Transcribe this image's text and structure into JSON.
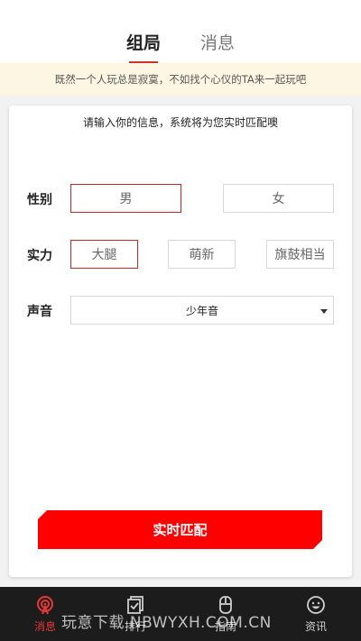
{
  "top_tabs": [
    {
      "label": "组局",
      "active": true
    },
    {
      "label": "消息",
      "active": false
    }
  ],
  "banner": {
    "text": "既然一个人玩总是寂寞，不如找个心仪的TA来一起玩吧"
  },
  "card": {
    "hint": "请输入你的信息，系统将为您实时匹配噢",
    "gender": {
      "label": "性别",
      "options": [
        "男",
        "女"
      ],
      "selected": "男"
    },
    "strength": {
      "label": "实力",
      "options": [
        "大腿",
        "萌新",
        "旗鼓相当"
      ],
      "selected": "大腿"
    },
    "voice": {
      "label": "声音",
      "selected": "少年音"
    },
    "match_button": "实时匹配"
  },
  "bottom_nav": [
    {
      "label": "消息",
      "icon": "broadcast-icon",
      "active": true
    },
    {
      "label": "排行",
      "icon": "checklist-icon",
      "active": false
    },
    {
      "label": "指南",
      "icon": "mouse-icon",
      "active": false
    },
    {
      "label": "资讯",
      "icon": "smiley-icon",
      "active": false
    }
  ],
  "watermark": "玩意下载 NBWYXH.COM.CN",
  "colors": {
    "accent": "#ff0000",
    "selected_border": "#c62828",
    "banner_bg": "#fdf6e3",
    "nav_bg": "#1c1c1c",
    "nav_active": "#e53935"
  }
}
